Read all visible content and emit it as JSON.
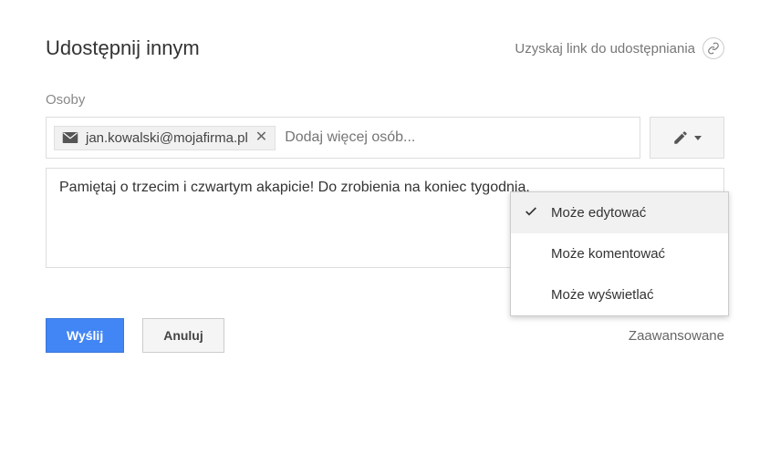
{
  "header": {
    "title": "Udostępnij innym",
    "share_link_label": "Uzyskaj link do udostępniania"
  },
  "people": {
    "label": "Osoby",
    "chip_email": "jan.kowalski@mojafirma.pl",
    "add_more_placeholder": "Dodaj więcej osób..."
  },
  "message": {
    "text": "Pamiętaj o trzecim i czwartym akapicie! Do zrobienia na koniec tygodnia."
  },
  "dropdown": {
    "items": [
      {
        "label": "Może edytować",
        "selected": true
      },
      {
        "label": "Może komentować",
        "selected": false
      },
      {
        "label": "Może wyświetlać",
        "selected": false
      }
    ]
  },
  "footer": {
    "send": "Wyślij",
    "cancel": "Anuluj",
    "advanced": "Zaawansowane"
  }
}
